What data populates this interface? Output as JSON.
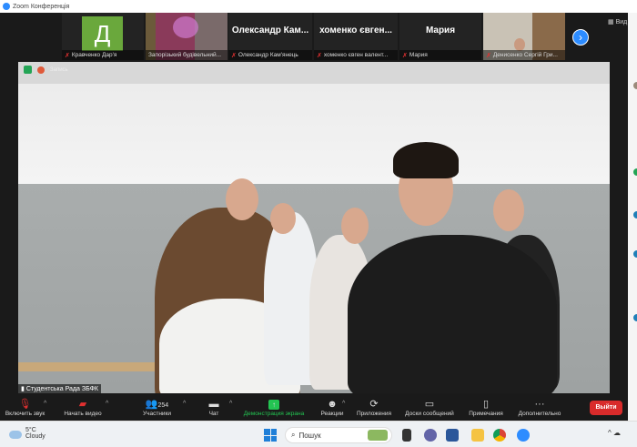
{
  "window": {
    "title": "Zoom Конференція"
  },
  "thumbnails": [
    {
      "initial": "Д",
      "name": "Кравченко Дар'я",
      "muted": true
    },
    {
      "name": "Запорізький будівельний...",
      "muted": false
    },
    {
      "display": "Олександр Кам...",
      "name": "Олександр Кам'янець",
      "muted": true
    },
    {
      "display": "хоменко євген...",
      "name": "хоменко євген валент...",
      "muted": true
    },
    {
      "display": "Мария",
      "name": "Мария",
      "muted": true
    },
    {
      "name": "Денисенко Сергій Гри...",
      "muted": true
    }
  ],
  "view_label": "Вид",
  "recording_label": "Запись",
  "active_speaker": "Студентська Рада ЗБФК",
  "toolbar": {
    "unmute": "Включить звук",
    "start_video": "Начать видео",
    "participants": "Участники",
    "participants_count": "254",
    "chat": "Чат",
    "share": "Демонстрация экрана",
    "reactions": "Реакции",
    "apps": "Приложения",
    "whiteboards": "Доски сообщений",
    "notes": "Примечания",
    "more": "Дополнительно",
    "leave": "Выйти"
  },
  "taskbar": {
    "temp": "5°C",
    "weather": "Cloudy",
    "search_placeholder": "Пошук"
  }
}
